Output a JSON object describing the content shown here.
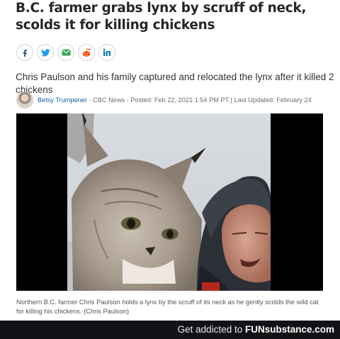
{
  "article": {
    "headline": "B.C. farmer grabs lynx by scruff of neck, scolds it for killing chickens",
    "deck": "Chris Paulson and his family captured and relocated the lynx after it killed 2 chickens",
    "byline": {
      "author": "Betsy Trumpener",
      "meta": " · CBC News · Posted: Feb 22, 2021 1:54 PM PT | Last Updated: February 24"
    },
    "caption": "Northern B.C. farmer Chris Paulson holds a lynx by the scruff of its neck as he gently scolds the wild cat for killing his chickens. (Chris Paulson)"
  },
  "share": [
    {
      "icon": "facebook-icon",
      "color": "#3b5998"
    },
    {
      "icon": "twitter-icon",
      "color": "#1da1f2"
    },
    {
      "icon": "email-icon",
      "color": "#3aa75a"
    },
    {
      "icon": "reddit-icon",
      "color": "#ff4500"
    },
    {
      "icon": "linkedin-icon",
      "color": "#0077b5"
    }
  ],
  "footer": {
    "prefix": "Get addicted to ",
    "brand": "FUNsubstance.com",
    "background": "#101215"
  }
}
